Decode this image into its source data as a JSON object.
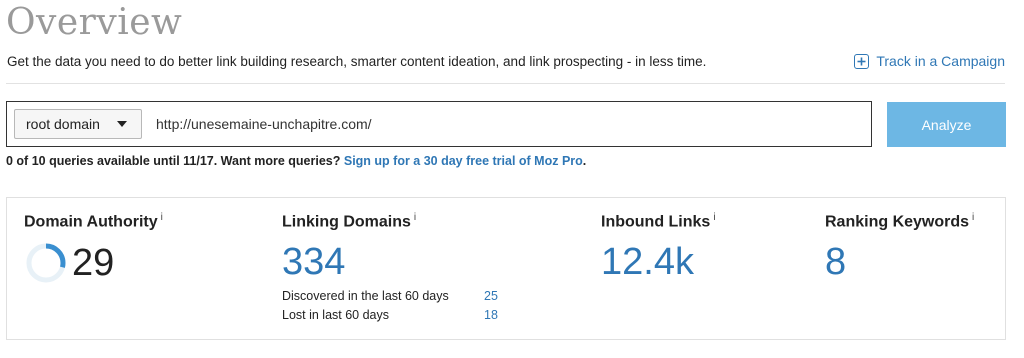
{
  "page": {
    "title": "Overview",
    "subtitle": "Get the data you need to do better link building research, smarter content ideation, and link prospecting - in less time.",
    "track_label": "Track in a Campaign",
    "track_icon": "plus-square-icon"
  },
  "search": {
    "scope_selected": "root domain",
    "url_value": "http://unesemaine-unchapitre.com/",
    "analyze_label": "Analyze"
  },
  "quota": {
    "text": "0 of 10 queries available until 11/17. Want more queries? ",
    "link_text": "Sign up for a 30 day free trial of Moz Pro",
    "suffix": "."
  },
  "metrics": {
    "info_glyph": "i",
    "domain_authority": {
      "label": "Domain Authority",
      "value": "29",
      "gauge_fraction": 0.29
    },
    "linking_domains": {
      "label": "Linking Domains",
      "value": "334",
      "discovered_label": "Discovered in the last 60 days",
      "discovered_value": "25",
      "lost_label": "Lost in last 60 days",
      "lost_value": "18"
    },
    "inbound_links": {
      "label": "Inbound Links",
      "value": "12.4k"
    },
    "ranking_keywords": {
      "label": "Ranking Keywords",
      "value": "8"
    }
  },
  "colors": {
    "accent": "#2f77b5",
    "analyze_button": "#6db7e4",
    "title_gray": "#9a9a9a",
    "gauge_track": "#e8f1f7",
    "gauge_fill": "#3a8fd0"
  }
}
